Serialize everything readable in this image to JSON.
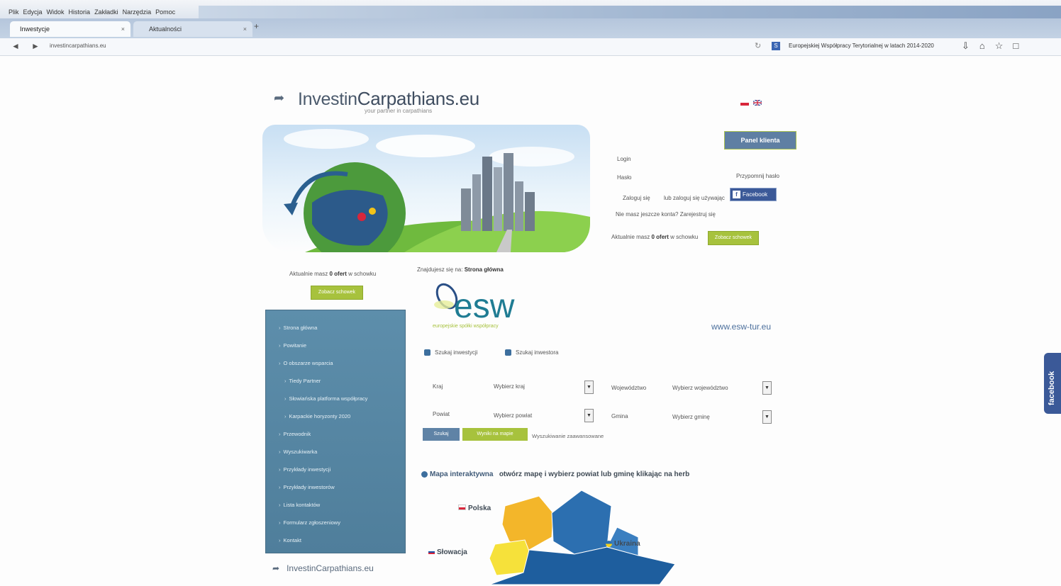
{
  "browser": {
    "menu": [
      "Plik",
      "Edycja",
      "Widok",
      "Historia",
      "Zakładki",
      "Narzędzia",
      "Pomoc"
    ],
    "tabs": [
      {
        "label": "Inwestycje",
        "close": "×"
      },
      {
        "label": "Aktualności",
        "close": "×"
      }
    ],
    "new_tab": "+",
    "url": "investincarpathians.eu",
    "search_text": "Europejskiej Współpracy Terytorialnej w latach 2014-2020",
    "search_engine_letter": "S"
  },
  "header": {
    "logo_prefix": "Investin",
    "logo_main": "Carpathians.eu",
    "tagline": "your partner in carpathians"
  },
  "colors": {
    "accent_green": "#a7c23d",
    "nav_blue": "#4f7e9b",
    "facebook": "#3b5998"
  },
  "login": {
    "panel_button": "Panel klienta",
    "login_label": "Login",
    "password_label": "Hasło",
    "forgot": "Przypomnij hasło",
    "signin": "Zaloguj się",
    "or_via": "lub zaloguj się używając",
    "facebook_button": "Facebook",
    "register": "Nie masz jeszcze konta? Zarejestruj się"
  },
  "basket": {
    "prefix": "Aktualnie masz",
    "count": "0 ofert",
    "suffix": "w schowku",
    "button": "Zobacz schowek"
  },
  "sidebar": {
    "items": [
      {
        "label": "Strona główna",
        "level": 1
      },
      {
        "label": "Powitanie",
        "level": 1
      },
      {
        "label": "O obszarze wsparcia",
        "level": 1
      },
      {
        "label": "Tiedy Partner",
        "level": 2
      },
      {
        "label": "Słowiańska platforma współpracy",
        "level": 2
      },
      {
        "label": "Karpackie horyzonty 2020",
        "level": 2
      },
      {
        "label": "Przewodnik",
        "level": 1
      },
      {
        "label": "Wyszukiwarka",
        "level": 1
      },
      {
        "label": "Przykłady inwestycji",
        "level": 1
      },
      {
        "label": "Przykłady inwestorów",
        "level": 1
      },
      {
        "label": "Lista kontaktów",
        "level": 1
      },
      {
        "label": "Formularz zgłoszeniowy",
        "level": 1
      },
      {
        "label": "Kontakt",
        "level": 1
      }
    ]
  },
  "footer": {
    "logo_prefix": "Investin",
    "logo_main": "Carpathians.eu"
  },
  "main": {
    "breadcrumb_prefix": "Znajdujesz się na:",
    "breadcrumb_current": "Strona główna",
    "esw_logo": "esw",
    "esw_tagline": "europejskie spółki współpracy",
    "esw_url": "www.esw-tur.eu",
    "search_tabs": [
      "Szukaj inwestycji",
      "Szukaj inwestora"
    ],
    "filters": {
      "country_label": "Kraj",
      "country_value": "Wybierz kraj",
      "voivodeship_label": "Województwo",
      "voivodeship_value": "Wybierz województwo",
      "district_label": "Powiat",
      "district_value": "Wybierz powiat",
      "commune_label": "Gmina",
      "commune_value": "Wybierz gminę"
    },
    "search_button": "Szukaj",
    "map_button": "Wyniki na mapie",
    "advanced": "Wyszukiwanie zaawansowane",
    "map_title_bold": "Mapa interaktywna",
    "map_title_rest": "otwórz mapę i wybierz powiat lub gminę klikając na herb",
    "map_labels": {
      "poland": "Polska",
      "slovakia": "Słowacja",
      "ukraine": "Ukraina"
    }
  },
  "facebook_side": "facebook"
}
